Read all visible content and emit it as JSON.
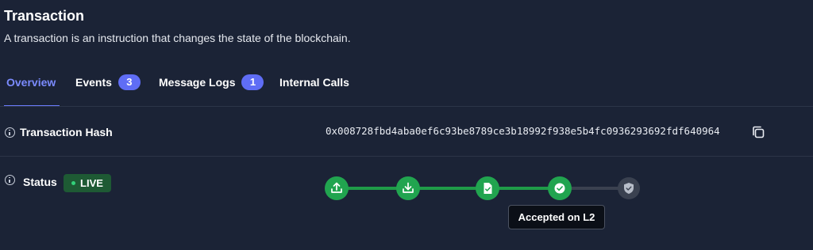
{
  "header": {
    "title": "Transaction",
    "subtitle": "A transaction is an instruction that changes the state of the blockchain."
  },
  "tabs": [
    {
      "label": "Overview",
      "active": true
    },
    {
      "label": "Events",
      "count": "3"
    },
    {
      "label": "Message Logs",
      "count": "1"
    },
    {
      "label": "Internal Calls"
    }
  ],
  "details": {
    "hash_label": "Transaction Hash",
    "hash_value": "0x008728fbd4aba0ef6c93be8789ce3b18992f938e5b4fc0936293692fdf640964",
    "status_label": "Status",
    "status_badge": "LIVE"
  },
  "progress": {
    "steps": [
      {
        "icon": "upload-icon",
        "done": true
      },
      {
        "icon": "download-icon",
        "done": true
      },
      {
        "icon": "file-check-icon",
        "done": true
      },
      {
        "icon": "check-circle-icon",
        "done": true
      },
      {
        "icon": "shield-check-icon",
        "done": false
      }
    ],
    "tooltip": "Accepted on L2"
  },
  "colors": {
    "background": "#1b2336",
    "accent": "#6c7cff",
    "success": "#21a44f",
    "badge": "#5f6df5"
  }
}
